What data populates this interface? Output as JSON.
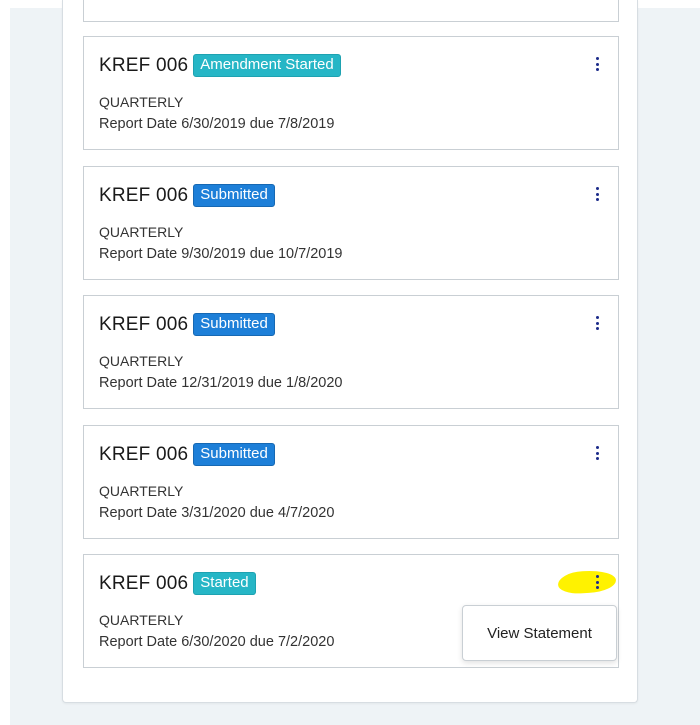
{
  "reports": [
    {
      "title": "KREF 006",
      "status": "Amendment Started",
      "frequency": "QUARTERLY",
      "report_date": "Report Date 6/30/2019 due 7/8/2019"
    },
    {
      "title": "KREF 006",
      "status": "Submitted",
      "frequency": "QUARTERLY",
      "report_date": "Report Date 9/30/2019 due 10/7/2019"
    },
    {
      "title": "KREF 006",
      "status": "Submitted",
      "frequency": "QUARTERLY",
      "report_date": "Report Date 12/31/2019 due 1/8/2020"
    },
    {
      "title": "KREF 006",
      "status": "Submitted",
      "frequency": "QUARTERLY",
      "report_date": "Report Date 3/31/2020 due 4/7/2020"
    },
    {
      "title": "KREF 006",
      "status": "Started",
      "frequency": "QUARTERLY",
      "report_date": "Report Date 6/30/2020 due 7/2/2020"
    }
  ],
  "menu": {
    "view_statement": "View Statement"
  },
  "colors": {
    "badge_teal": "#26b6c6",
    "badge_blue": "#1d7fd8",
    "kebab": "#1b2a8a",
    "highlight": "#fff200"
  },
  "icons": {
    "kebab": "kebab-menu-icon"
  }
}
